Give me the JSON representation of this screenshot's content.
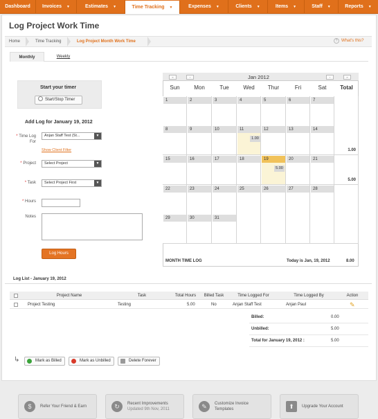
{
  "nav": {
    "items": [
      {
        "label": "Dashboard",
        "caret": ""
      },
      {
        "label": "Invoices",
        "caret": "▼"
      },
      {
        "label": "Estimates",
        "caret": "▼"
      },
      {
        "label": "Time Tracking",
        "caret": "▼"
      },
      {
        "label": "Expenses",
        "caret": "▼"
      },
      {
        "label": "Clients",
        "caret": "▼"
      },
      {
        "label": "Items",
        "caret": "▼"
      },
      {
        "label": "Staff",
        "caret": "▼"
      },
      {
        "label": "Reports",
        "caret": "▼"
      }
    ],
    "active_index": 3,
    "accent": "#e0701b"
  },
  "page_title": "Log Project Work Time",
  "breadcrumb": [
    "Home",
    "Time Tracking",
    "Log Project Month Work Time"
  ],
  "help_label": "What's this?",
  "tabs": [
    "Monthly",
    "Weekly"
  ],
  "timer": {
    "title": "Start your timer",
    "button": "Start/Stop Timer"
  },
  "form": {
    "heading": "Add Log for January 19, 2012",
    "time_log_for_label": "Time Log For",
    "time_log_for_value": "Anjan Staff Test (St...",
    "show_client_filter": "Show Client Filter",
    "project_label": "Project",
    "project_value": "Select Project",
    "task_label": "Task",
    "task_value": "Select Project First",
    "hours_label": "Hours",
    "hours_value": "",
    "notes_label": "Notes",
    "notes_value": "",
    "submit": "Log Hours",
    "required_mark": "*"
  },
  "calendar": {
    "month": "Jan 2012",
    "nav": {
      "prev_year": "«",
      "prev": "‹",
      "next": "›",
      "next_year": "»"
    },
    "weekdays": [
      "Sun",
      "Mon",
      "Tue",
      "Wed",
      "Thur",
      "Fri",
      "Sat",
      "Total"
    ],
    "weeks": [
      {
        "days": [
          "1",
          "2",
          "3",
          "4",
          "5",
          "6",
          "7"
        ],
        "total": ""
      },
      {
        "days": [
          "8",
          "9",
          "10",
          "11",
          "12",
          "13",
          "14"
        ],
        "total": "1.00"
      },
      {
        "days": [
          "15",
          "16",
          "17",
          "18",
          "19",
          "20",
          "21"
        ],
        "total": "5.00"
      },
      {
        "days": [
          "22",
          "23",
          "24",
          "25",
          "26",
          "27",
          "28"
        ],
        "total": ""
      },
      {
        "days": [
          "29",
          "30",
          "31",
          "",
          "",
          "",
          ""
        ],
        "total": ""
      }
    ],
    "entries": [
      {
        "day": "11",
        "hours": "1.00"
      },
      {
        "day": "19",
        "hours": "5.00"
      }
    ],
    "today_day": "19",
    "footer_label": "MONTH TIME LOG",
    "today_label": "Today is Jan, 19, 2012",
    "month_total": "8.00"
  },
  "log_list": {
    "title": "Log List - January 19, 2012",
    "columns": [
      "Project Name",
      "Task",
      "Total Hours",
      "Billed Task",
      "Time Logged For",
      "Time Logged By",
      "Action"
    ],
    "rows": [
      {
        "project": "Project Testing",
        "task": "Testing",
        "hours": "5.00",
        "billed": "No",
        "logged_for": "Anjan Staff Test",
        "logged_by": "Anjan Paul"
      }
    ],
    "summary": [
      {
        "label": "Billed:",
        "value": "0.00"
      },
      {
        "label": "Unbilled:",
        "value": "5.00"
      },
      {
        "label": "Total for January 19, 2012 :",
        "value": "5.00"
      }
    ],
    "actions": [
      "Mark as Billed",
      "Mark as Unbilled",
      "Delete Forever"
    ]
  },
  "footer": [
    {
      "line1": "Refer Your Friend & Earn",
      "line2": "",
      "icon": "dollar-icon"
    },
    {
      "line1": "Recent Improvements",
      "line2": "Updated 9th Nov, 2011",
      "icon": "refresh-icon"
    },
    {
      "line1": "Customize Invoice",
      "line2": "Templates",
      "icon": "edit-icon"
    },
    {
      "line1": "Upgrade Your Account",
      "line2": "",
      "icon": "upgrade-arrow-icon"
    }
  ]
}
